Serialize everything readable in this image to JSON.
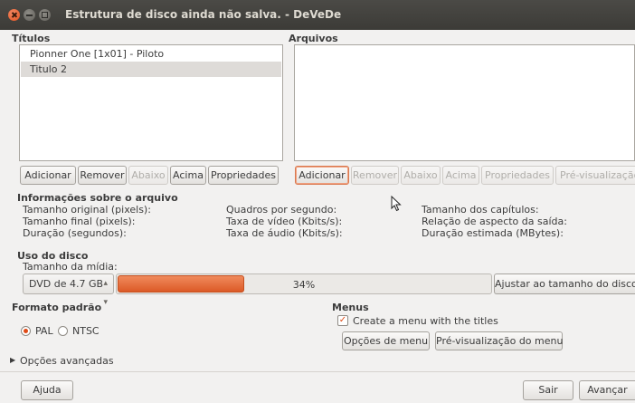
{
  "window": {
    "title": "Estrutura de disco ainda não salva. - DeVeDe"
  },
  "titles": {
    "label": "Títulos",
    "items": [
      "Pionner One [1x01] - Piloto",
      "Titulo 2"
    ],
    "buttons": {
      "add": "Adicionar",
      "remove": "Remover",
      "down": "Abaixo",
      "up": "Acima",
      "properties": "Propriedades"
    }
  },
  "files": {
    "label": "Arquivos",
    "buttons": {
      "add": "Adicionar",
      "remove": "Remover",
      "down": "Abaixo",
      "up": "Acima",
      "properties": "Propriedades",
      "preview": "Pré-visualização"
    }
  },
  "file_info": {
    "label": "Informações sobre o arquivo",
    "col1": [
      "Tamanho original (pixels):",
      "Tamanho final (pixels):",
      "Duração (segundos):"
    ],
    "col2": [
      "Quadros por segundo:",
      "Taxa de vídeo (Kbits/s):",
      "Taxa de áudio (Kbits/s):"
    ],
    "col3": [
      "Tamanho dos capítulos:",
      "Relação de aspecto da saída:",
      "Duração estimada (MBytes):"
    ]
  },
  "disk_usage": {
    "label": "Uso do disco",
    "media_size_label": "Tamanho da mídia:",
    "media_selected": "DVD de 4.7 GB",
    "usage_percent": 34,
    "usage_text": "34%",
    "fit_button": "Ajustar ao tamanho do disco"
  },
  "format": {
    "label": "Formato padrão",
    "options": [
      "PAL",
      "NTSC"
    ],
    "selected": "PAL"
  },
  "menus": {
    "label": "Menus",
    "create_menu_label": "Create a menu with the titles",
    "create_menu_checked": true,
    "options_button": "Opções de menu",
    "preview_button": "Pré-visualização do menu"
  },
  "advanced": {
    "label": "Opções avançadas"
  },
  "footer": {
    "help": "Ajuda",
    "quit": "Sair",
    "next": "Avançar"
  },
  "colors": {
    "accent": "#df4a16",
    "titlebar": "#3c3b37",
    "background": "#f2f1f0"
  }
}
